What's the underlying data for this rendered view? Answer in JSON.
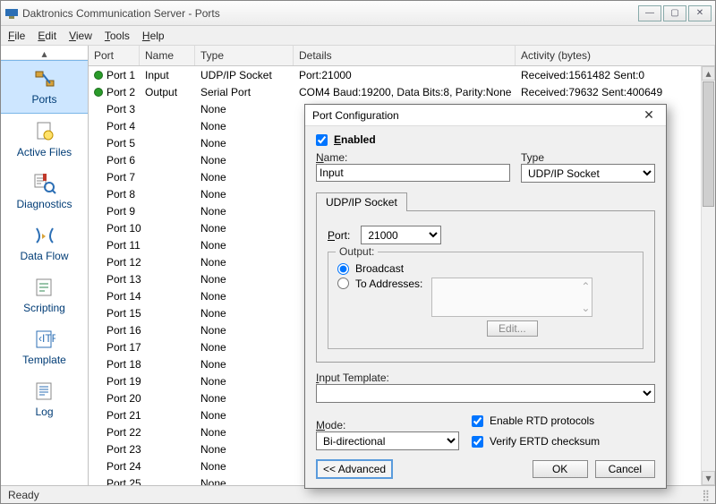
{
  "window": {
    "title": "Daktronics Communication Server - Ports"
  },
  "menu": {
    "file": "File",
    "edit": "Edit",
    "view": "View",
    "tools": "Tools",
    "help": "Help"
  },
  "sidebar": {
    "items": [
      {
        "label": "Ports"
      },
      {
        "label": "Active Files"
      },
      {
        "label": "Diagnostics"
      },
      {
        "label": "Data Flow"
      },
      {
        "label": "Scripting"
      },
      {
        "label": "Template"
      },
      {
        "label": "Log"
      }
    ]
  },
  "columns": {
    "port": "Port",
    "name": "Name",
    "type": "Type",
    "details": "Details",
    "activity": "Activity  (bytes)"
  },
  "rows": [
    {
      "active": true,
      "port": "Port  1",
      "name": "Input",
      "type": "UDP/IP Socket",
      "details": "Port:21000",
      "activity": "Received:1561482   Sent:0"
    },
    {
      "active": true,
      "port": "Port  2",
      "name": "Output",
      "type": "Serial Port",
      "details": "COM4 Baud:19200, Data Bits:8, Parity:None",
      "activity": "Received:79632   Sent:400649"
    },
    {
      "port": "Port  3",
      "type": "None"
    },
    {
      "port": "Port  4",
      "type": "None"
    },
    {
      "port": "Port  5",
      "type": "None"
    },
    {
      "port": "Port  6",
      "type": "None"
    },
    {
      "port": "Port  7",
      "type": "None"
    },
    {
      "port": "Port  8",
      "type": "None"
    },
    {
      "port": "Port  9",
      "type": "None"
    },
    {
      "port": "Port 10",
      "type": "None"
    },
    {
      "port": "Port 11",
      "type": "None"
    },
    {
      "port": "Port 12",
      "type": "None"
    },
    {
      "port": "Port 13",
      "type": "None"
    },
    {
      "port": "Port 14",
      "type": "None"
    },
    {
      "port": "Port 15",
      "type": "None"
    },
    {
      "port": "Port 16",
      "type": "None"
    },
    {
      "port": "Port 17",
      "type": "None"
    },
    {
      "port": "Port 18",
      "type": "None"
    },
    {
      "port": "Port 19",
      "type": "None"
    },
    {
      "port": "Port 20",
      "type": "None"
    },
    {
      "port": "Port 21",
      "type": "None"
    },
    {
      "port": "Port 22",
      "type": "None"
    },
    {
      "port": "Port 23",
      "type": "None"
    },
    {
      "port": "Port 24",
      "type": "None"
    },
    {
      "port": "Port 25",
      "type": "None"
    }
  ],
  "status": {
    "text": "Ready"
  },
  "dialog": {
    "title": "Port Configuration",
    "enabled_label": "Enabled",
    "name_label": "Name:",
    "name_value": "Input",
    "type_label": "Type",
    "type_value": "UDP/IP Socket",
    "tab_label": "UDP/IP Socket",
    "port_label": "Port:",
    "port_value": "21000",
    "output_group": "Output:",
    "broadcast_label": "Broadcast",
    "toaddr_label": "To Addresses:",
    "edit_btn": "Edit...",
    "input_template_label": "Input Template:",
    "input_template_value": "",
    "mode_label": "Mode:",
    "mode_value": "Bi-directional",
    "enable_rtd_label": "Enable RTD protocols",
    "verify_ertd_label": "Verify ERTD checksum",
    "advanced_btn": "<< Advanced",
    "ok_btn": "OK",
    "cancel_btn": "Cancel"
  }
}
